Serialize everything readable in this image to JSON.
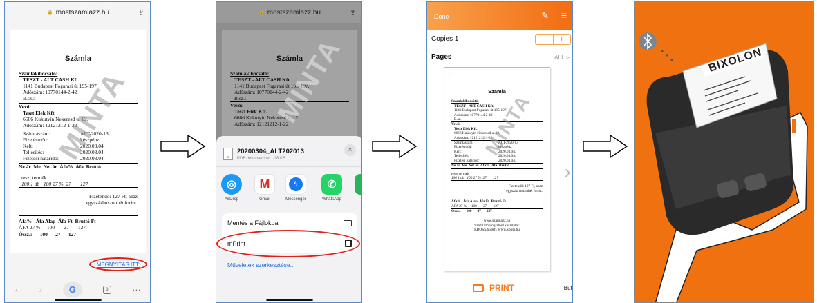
{
  "panel1": {
    "url": "mostszamlazz.hu",
    "open_link": "MEGNYITÁS ITT:"
  },
  "invoice": {
    "title": "Számla",
    "issuer_label": "Számlakibocsátó:",
    "issuer_name": "TESZT - ALT CASH Kft.",
    "issuer_address": "1141 Budapest Fogarasi út 195-197.",
    "issuer_tax": "Adószám: 10770144-2-42",
    "issuer_bank": "B.sz.: -",
    "buyer_label": "Vevő:",
    "buyer_name": "Teszt Elek Kft.",
    "buyer_address": "6666 Kukutyin Nekeresd u. 12.",
    "buyer_tax": "Adószám: 12121212-1-22",
    "meta_rows": [
      {
        "label": "Számlaszám:",
        "value": "ALT-2020-13"
      },
      {
        "label": "Fizetésmód:",
        "value": "készpénz"
      },
      {
        "label": "Kelt:",
        "value": "2020.03.04."
      },
      {
        "label": "Teljesítés:",
        "value": "2020.03.04."
      },
      {
        "label": "Fizetési határidő:",
        "value": "2020.03.04."
      }
    ],
    "items_header": "Ne.ár  Me  Net.ár  Áfa%  Áfa  Bruttó",
    "item_name": "teszt termék",
    "item_row": "100 1 db   100 27 %  27       127",
    "payable_line1": "Fizetendő: 127 Ft, azaz",
    "payable_line2": "egyszázhuszonhét forint.",
    "vat_header": "Áfa%   Áfa Alap  Áfa Ft  Bruttó Ft",
    "vat_row": "ÁFA 27 %     100       27       127",
    "vat_total": "Össz.:      100      27      127",
    "footer1": "www.szamlazz.hu",
    "footer2": "Számlázóprogramot készítette:",
    "footer3": "KBOSS.hu Kft. www.kboss.hu",
    "watermark": "MINTA"
  },
  "panel2": {
    "url": "mostszamlazz.hu",
    "file_name": "20200304_ALT202013",
    "file_meta": "PDF dokumentum · 28 KB",
    "apps": [
      {
        "label": "AirDrop",
        "color": "#1a9af5",
        "glyph": "◎"
      },
      {
        "label": "Gmail",
        "color": "#ffffff",
        "glyph": "M"
      },
      {
        "label": "Messenger",
        "color": "#1877f2",
        "glyph": "⚡"
      },
      {
        "label": "WhatsApp",
        "color": "#25d366",
        "glyph": "✆"
      }
    ],
    "save_files": "Mentés a Fájlokba",
    "mprint": "mPrint",
    "edit_actions": "Műveletek szerkesztése..."
  },
  "panel3": {
    "done": "Done",
    "copies_label": "Copies 1",
    "minus": "−",
    "plus": "+",
    "pages_label": "Pages",
    "all_label": "ALL >",
    "print_label": "PRINT",
    "side_text": "Butt"
  },
  "panel4": {
    "brand": "BIXOLON"
  },
  "colors": {
    "orange": "#f47b20",
    "panel_border": "#5b8bc7",
    "highlight_red": "#e0201b",
    "link_blue": "#1a6fe0"
  }
}
